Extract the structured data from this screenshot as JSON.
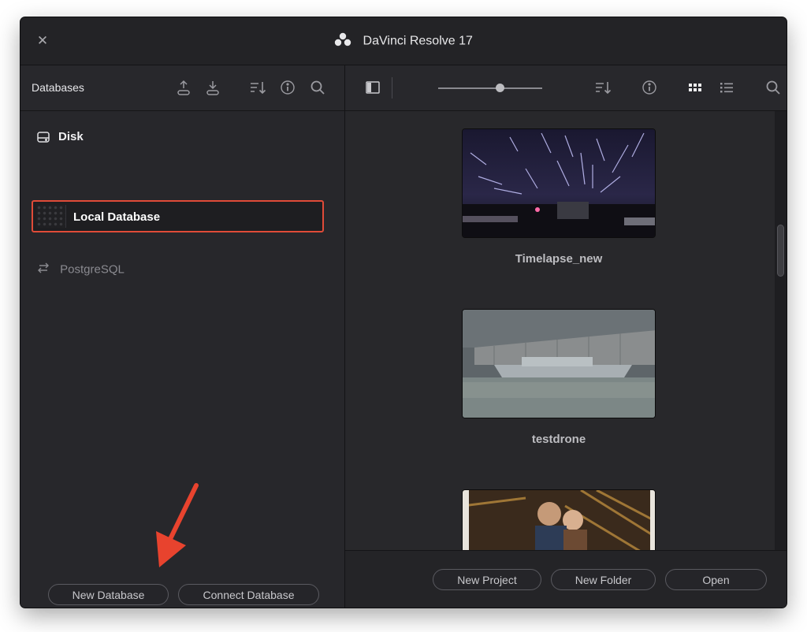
{
  "window": {
    "title": "DaVinci Resolve 17",
    "close_icon": "close-icon",
    "logo_icon": "davinci-logo-icon"
  },
  "left_panel": {
    "header_title": "Databases",
    "toolbar_icons": [
      "upload-icon",
      "download-icon",
      "sort-icon",
      "info-icon",
      "search-icon"
    ],
    "sections": [
      {
        "label": "Disk",
        "icon": "disk-icon",
        "items": [
          {
            "label": "Local Database",
            "selected": true
          }
        ]
      },
      {
        "label": "PostgreSQL",
        "icon": "network-arrows-icon",
        "items": []
      }
    ],
    "buttons": {
      "new_database": "New Database",
      "connect_database": "Connect Database"
    }
  },
  "right_panel": {
    "toolbar_icons": [
      "sidebar-toggle-icon",
      "sort-icon",
      "info-icon",
      "grid-view-icon",
      "list-view-icon",
      "search-icon"
    ],
    "thumbnail_zoom": 0.6,
    "view_mode": "grid",
    "projects": [
      {
        "name": "Timelapse_new",
        "thumb": "night-timelapse"
      },
      {
        "name": "testdrone",
        "thumb": "harbor-ship"
      },
      {
        "name": "",
        "thumb": "couple-portrait"
      }
    ],
    "buttons": {
      "new_project": "New Project",
      "new_folder": "New Folder",
      "open": "Open"
    }
  },
  "annotation": {
    "type": "red-arrow",
    "color": "#e8432e",
    "points_to": "new-database-button"
  },
  "colors": {
    "selection_border": "#e04b38",
    "panel_bg": "#27272b",
    "window_bg": "#1f1f22"
  }
}
